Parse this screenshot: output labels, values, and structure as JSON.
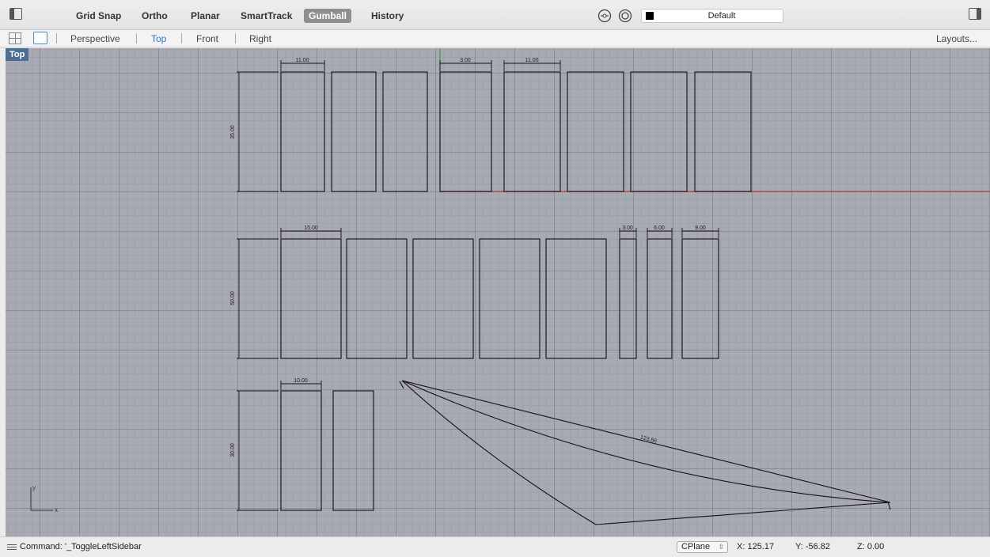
{
  "toolbar": {
    "modes": [
      "Grid Snap",
      "Ortho",
      "Planar",
      "SmartTrack",
      "Gumball",
      "History"
    ],
    "active_mode": "Gumball",
    "layer_name": "Default",
    "layer_color": "#000000"
  },
  "viewport_tabs": {
    "tabs": [
      "Perspective",
      "Top",
      "Front",
      "Right"
    ],
    "active_tab": "Top",
    "layouts_label": "Layouts..."
  },
  "viewport": {
    "label": "Top",
    "background": "#a7aab2",
    "dimensions": {
      "row1_height": "35.00",
      "row1_width_a": "11.00",
      "row1_width_b": "3.00",
      "row1_width_c": "11.00",
      "row2_height": "50.00",
      "row2_width_a": "15.00",
      "row2_width_b": "3.00",
      "row2_width_c": "6.00",
      "row2_width_d": "9.00",
      "row3_height": "30.00",
      "row3_width_a": "10.00",
      "curve_length": "123.86"
    },
    "axis_labels": {
      "x": "x",
      "y": "y"
    },
    "axis_colors": {
      "x": "#c23a3a",
      "y": "#3aa23a"
    }
  },
  "statusbar": {
    "command": "Command: '_ToggleLeftSidebar",
    "cplane": "CPlane",
    "x": "X: 125.17",
    "y": "Y: -56.82",
    "z": "Z: 0.00"
  }
}
